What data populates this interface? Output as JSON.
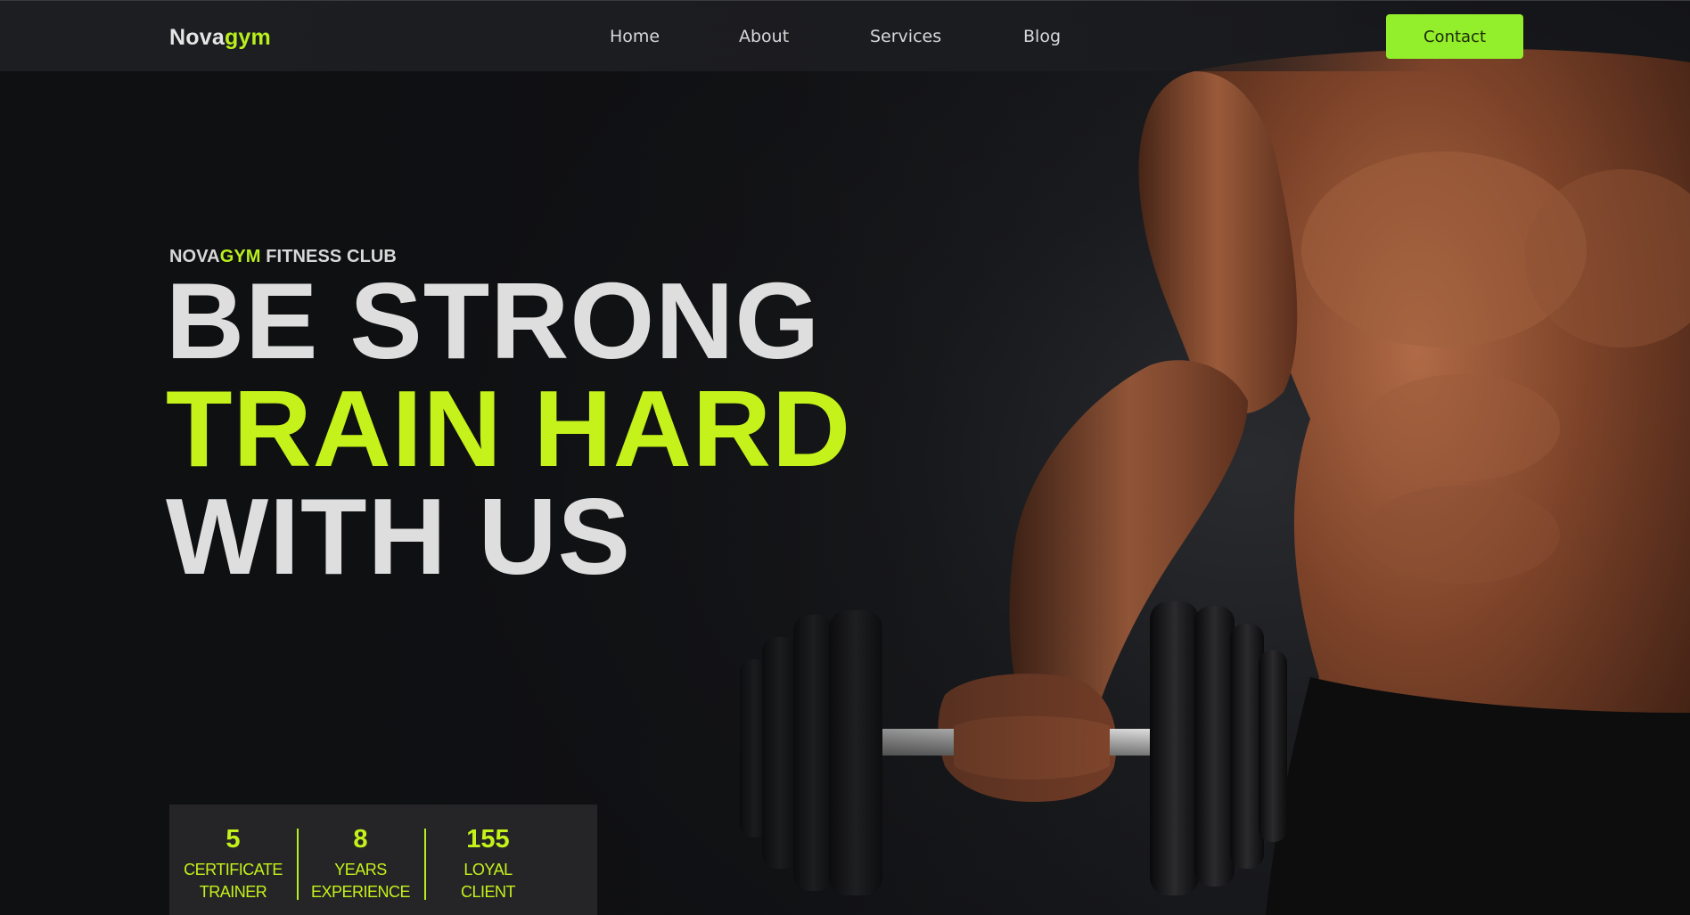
{
  "brand": {
    "name_part1": "Nova",
    "name_part2": "gym",
    "accent_color": "#b9ef1d"
  },
  "nav": {
    "items": [
      {
        "label": "Home"
      },
      {
        "label": "About"
      },
      {
        "label": "Services"
      },
      {
        "label": "Blog"
      }
    ],
    "cta_label": "Contact",
    "cta_color": "#93ee2b"
  },
  "hero": {
    "eyebrow_part1": "NOVA",
    "eyebrow_part2": "GYM",
    "eyebrow_part3": " FITNESS CLUB",
    "headline_line1": "BE STRONG",
    "headline_line2": "TRAIN HARD",
    "headline_line3": "WITH US",
    "image": "muscular-man-holding-dumbbell"
  },
  "stats": [
    {
      "value": "5",
      "label_line1": "CERTIFICATE",
      "label_line2": "TRAINER"
    },
    {
      "value": "8",
      "label_line1": "YEARS",
      "label_line2": "EXPERIENCE"
    },
    {
      "value": "155",
      "label_line1": "LOYAL",
      "label_line2": "CLIENT"
    }
  ]
}
